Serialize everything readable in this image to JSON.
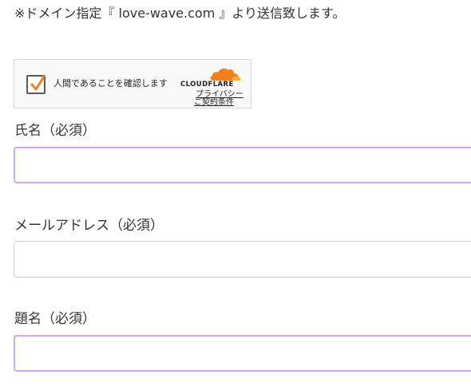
{
  "notice": "※ドメイン指定『 love-wave.com 』より送信致します。",
  "captcha": {
    "label": "人間であることを確認します",
    "brand": "CLOUDFLARE",
    "privacy_link": "プライバシー",
    "terms_link": "ご契約条件",
    "checkmark_color": "#f38020",
    "brand_color": "#f38020"
  },
  "form": {
    "fields": [
      {
        "label": "氏名（必須）",
        "value": "",
        "placeholder": ""
      },
      {
        "label": "メールアドレス（必須）",
        "value": "",
        "placeholder": ""
      },
      {
        "label": "題名（必須）",
        "value": "",
        "placeholder": ""
      }
    ],
    "focus_border_color": "#cfa6ef",
    "default_border_color": "#cfcfcf"
  }
}
